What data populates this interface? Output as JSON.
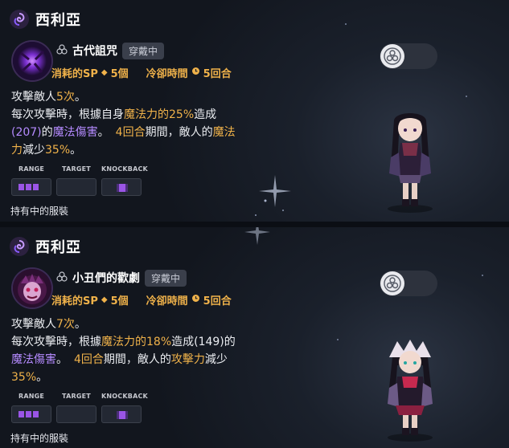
{
  "colors": {
    "accent": "#f0b24a",
    "purple": "#b58bff",
    "bar_fill": "#9a55e6",
    "background": "#12161e"
  },
  "cards": [
    {
      "type_icon": "spiral-magic-icon",
      "character_name": "西利亞",
      "skill_icon": "dark-orb-skill-icon",
      "skill_type_icon": "clover-icon",
      "skill_name": "古代詛咒",
      "equipped_badge": "穿戴中",
      "sp_label": "消耗的SP",
      "sp_value": "5個",
      "cooldown_label": "冷卻時間",
      "cooldown_value": "5回合",
      "desc": {
        "l1_a": "攻擊敵人",
        "l1_b": "5次",
        "l1_c": "。",
        "l2_a": "每次攻擊時，根據自身",
        "l2_b": "魔法力的25%",
        "l2_c": "造成",
        "l3_a": "(207)",
        "l3_b": "的",
        "l3_c": "魔法傷害",
        "l3_d": "。",
        "l3_e": "4回合",
        "l3_f": "期間，敵人的",
        "l3_g": "魔法",
        "l4_a": "力",
        "l4_b": "減少",
        "l4_c": "35%",
        "l4_d": "。"
      },
      "stats": {
        "range": "RANGE",
        "target": "TARGET",
        "knockback": "KNOCKBACK"
      },
      "owned_label": "持有中的服裝",
      "toggle_icon": "three-circles-icon"
    },
    {
      "type_icon": "spiral-magic-icon",
      "character_name": "西利亞",
      "skill_icon": "jester-mask-skill-icon",
      "skill_type_icon": "clover-icon",
      "skill_name": "小丑們的歡劇",
      "equipped_badge": "穿戴中",
      "sp_label": "消耗的SP",
      "sp_value": "5個",
      "cooldown_label": "冷卻時間",
      "cooldown_value": "5回合",
      "desc": {
        "l1_a": "攻擊敵人",
        "l1_b": "7次",
        "l1_c": "。",
        "l2_a": "每次攻擊時，根據",
        "l2_b": "魔法力的18%",
        "l2_c": "造成(149)的",
        "l3_a": "魔法傷害",
        "l3_b": "。",
        "l3_c": "4回合",
        "l3_d": "期間，敵人的",
        "l3_e": "攻擊力",
        "l3_f": "減少",
        "l4_a": "35%",
        "l4_b": "。"
      },
      "stats": {
        "range": "RANGE",
        "target": "TARGET",
        "knockback": "KNOCKBACK"
      },
      "owned_label": "持有中的服裝",
      "toggle_icon": "three-circles-icon"
    }
  ]
}
